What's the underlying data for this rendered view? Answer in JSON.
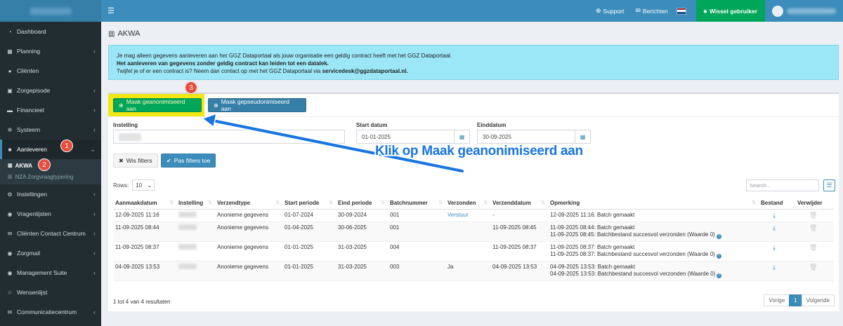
{
  "sidebar": {
    "items": [
      {
        "label": "Dashboard",
        "icon": "dashboard-icon",
        "glyph": "◔",
        "chevron": false
      },
      {
        "label": "Planning",
        "icon": "calendar-icon",
        "glyph": "▦",
        "chevron": true
      },
      {
        "label": "Cliënten",
        "icon": "user-icon",
        "glyph": "●",
        "chevron": false
      },
      {
        "label": "Zorgepisode",
        "icon": "briefcase-icon",
        "glyph": "▣",
        "chevron": true
      },
      {
        "label": "Financieel",
        "icon": "money-icon",
        "glyph": "▬",
        "chevron": true
      },
      {
        "label": "Systeem",
        "icon": "gears-icon",
        "glyph": "✲",
        "chevron": true
      },
      {
        "label": "Aanleveren",
        "icon": "send-icon",
        "glyph": "■",
        "chevron": true,
        "expanded": true
      },
      {
        "label": "Instellingen",
        "icon": "cog-icon",
        "glyph": "⚙",
        "chevron": true
      },
      {
        "label": "Vragenlijsten",
        "icon": "globe-icon",
        "glyph": "◉",
        "chevron": true
      },
      {
        "label": "Cliënten Contact Centrum",
        "icon": "envelope-icon",
        "glyph": "✉",
        "chevron": true
      },
      {
        "label": "Zorgmail",
        "icon": "globe-icon",
        "glyph": "◉",
        "chevron": true
      },
      {
        "label": "Management Suite",
        "icon": "globe-icon",
        "glyph": "◉",
        "chevron": true
      },
      {
        "label": "Wensenlijst",
        "icon": "star-icon",
        "glyph": "☆",
        "chevron": false
      },
      {
        "label": "Communicatiecentrum",
        "icon": "envelope-icon",
        "glyph": "✉",
        "chevron": true
      }
    ],
    "sub_items": [
      {
        "label": "AKWA",
        "active": true
      },
      {
        "label": "NZA Zorgvraagtypering",
        "active": false
      }
    ]
  },
  "topbar": {
    "support": "Support",
    "messages": "Berichten",
    "switch_user": "Wissel gebruiker"
  },
  "page": {
    "title": "AKWA"
  },
  "callout": {
    "line1": "Je mag alleen gegevens aanleveren aan het GGZ Dataportaal als jouw organisatie een geldig contract heeft met het GGZ Dataportaal.",
    "line2": "Het aanleveren van gegevens zonder geldig contract kan leiden tot een datalek.",
    "line3_prefix": "Twijfel je of er een contract is? Neem dan contact op met het GGZ Dataportaal via ",
    "line3_email": "servicedesk@ggzdataportaal.nl."
  },
  "buttons": {
    "anonymized": "Maak geanonimiseerd aan",
    "pseudonymized": "Maak gepseudonimiseerd aan",
    "clear_filters": "Wis filters",
    "apply_filters": "Pas filters toe"
  },
  "filters": {
    "instelling_label": "Instelling",
    "start_label": "Start datum",
    "start_value": "01-01-2025",
    "end_label": "Einddatum",
    "end_value": "30-09-2025"
  },
  "table_controls": {
    "rows_label": "Rows:",
    "rows_value": "10",
    "search_placeholder": "Search..."
  },
  "table": {
    "columns": [
      "Aanmaakdatum",
      "Instelling",
      "Verzendtype",
      "Start periode",
      "Eind periode",
      "Batchnummer",
      "Verzonden",
      "Verzenddatum",
      "Opmerking",
      "Bestand",
      "Verwijder"
    ],
    "rows": [
      {
        "aanmaak": "12-09-2025 11:16",
        "type": "Anonieme gegevens",
        "start": "01-07-2024",
        "eind": "30-09-2024",
        "batch": "001",
        "verzonden": "Verstuur",
        "verzonden_link": true,
        "datum": "-",
        "opm1": "12-09-2025 11:16: Batch gemaakt",
        "opm2": ""
      },
      {
        "aanmaak": "11-09-2025 08:44",
        "type": "Anonieme gegevens",
        "start": "01-04-2025",
        "eind": "30-06-2025",
        "batch": "001",
        "verzonden": "",
        "verzonden_link": false,
        "datum": "11-09-2025 08:45",
        "opm1": "11-09-2025 08:44: Batch gemaakt",
        "opm2": "11-09-2025 08:45: Batchbestand succesvol verzonden (Waarde 0)"
      },
      {
        "aanmaak": "11-09-2025 08:37",
        "type": "Anonieme gegevens",
        "start": "01-01-2025",
        "eind": "31-03-2025",
        "batch": "004",
        "verzonden": "",
        "verzonden_link": false,
        "datum": "11-09-2025 08:37",
        "opm1": "11-09-2025 08:37: Batch gemaakt",
        "opm2": "11-09-2025 08:37: Batchbestand succesvol verzonden (Waarde 0)"
      },
      {
        "aanmaak": "04-09-2025 13:53",
        "type": "Anonieme gegevens",
        "start": "01-01-2025",
        "eind": "31-03-2025",
        "batch": "003",
        "verzonden": "Ja",
        "verzonden_link": false,
        "datum": "04-09-2025 13:53",
        "opm1": "04-09-2025 13:53: Batch gemaakt",
        "opm2": "04-09-2025 13:53: Batchbestand succesvol verzonden (Waarde 0)"
      }
    ]
  },
  "pagination": {
    "summary": "1 tot 4 van 4 resultaten",
    "prev": "Vorige",
    "current": "1",
    "next": "Volgende"
  },
  "annotations": {
    "badge1": "1",
    "badge2": "2",
    "badge3": "3",
    "instruction": "Klik op Maak geanonimiseerd aan"
  },
  "colors": {
    "sidebar_bg": "#222d32",
    "topbar_bg": "#3c8dbc",
    "success": "#00a65a",
    "highlight": "#f2e713",
    "badge": "#e74c3c",
    "annotation_blue": "#1875e0",
    "callout_bg": "#9be7f7"
  }
}
